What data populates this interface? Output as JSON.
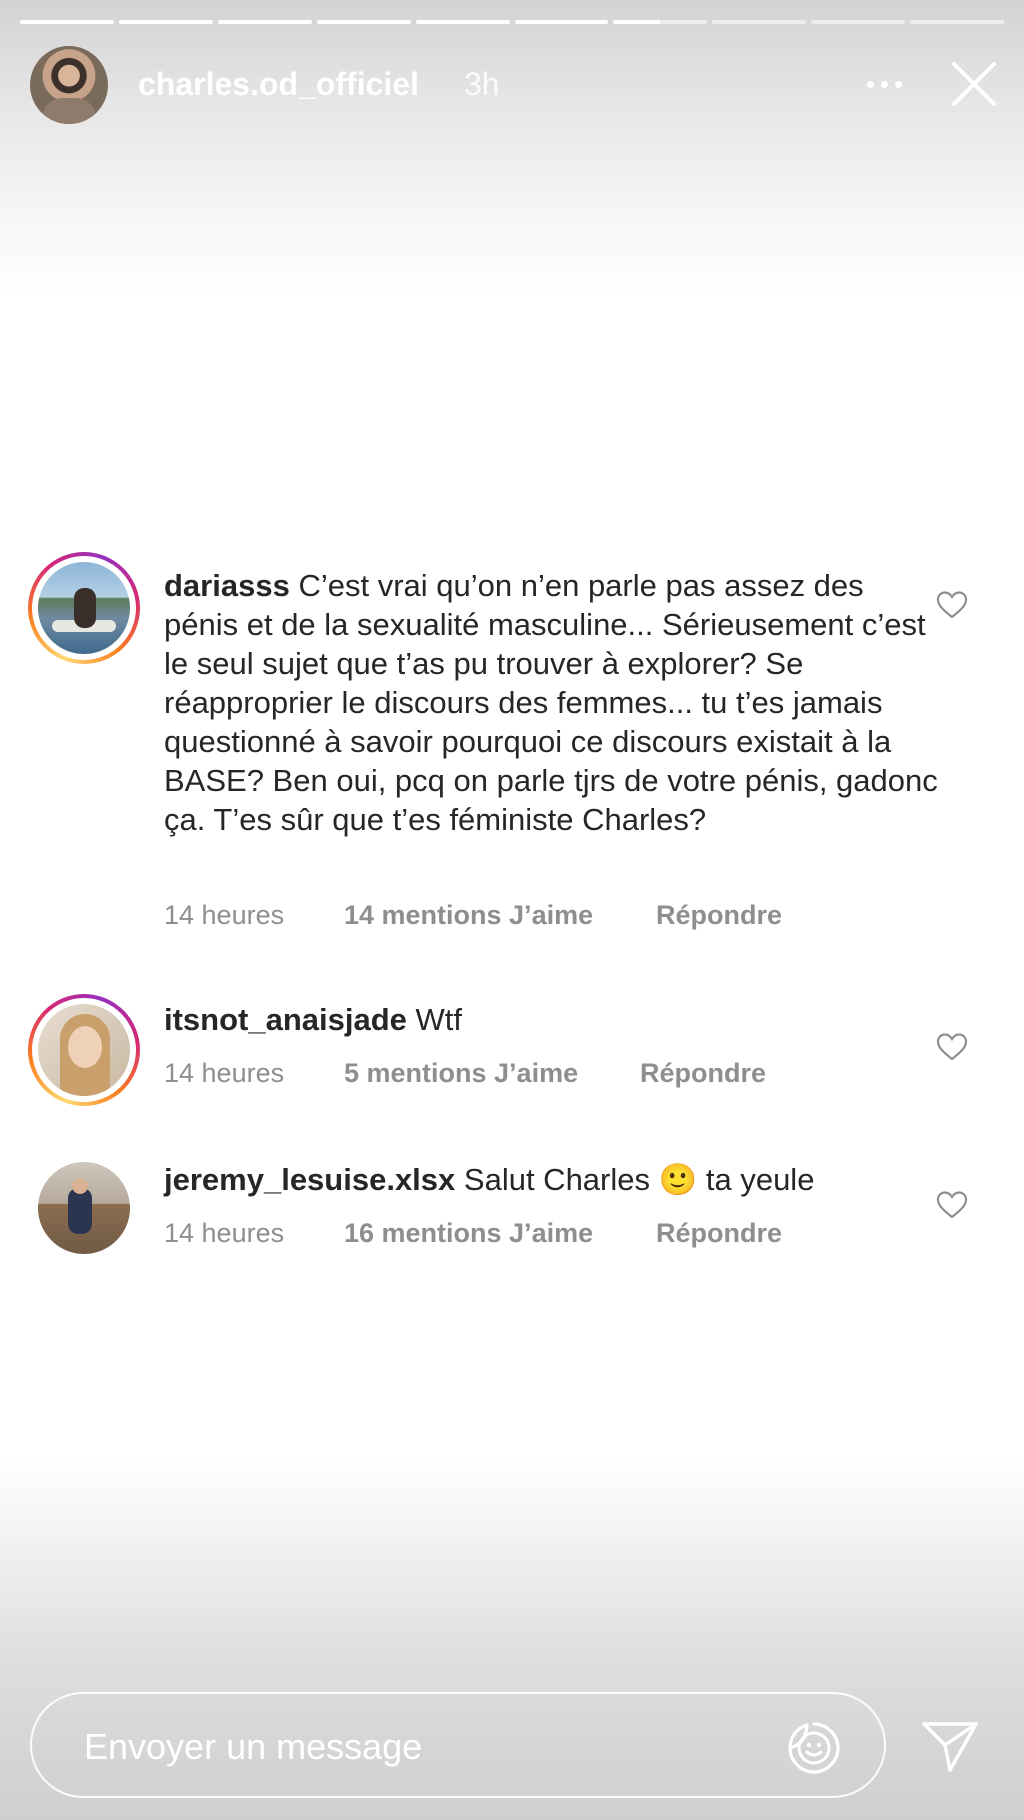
{
  "story": {
    "username": "charles.od_officiel",
    "time": "3h",
    "progress_segments": [
      1,
      1,
      1,
      1,
      1,
      1,
      0.5,
      0,
      0,
      0
    ]
  },
  "comments": [
    {
      "username": "dariasss",
      "text": "C’est vrai qu’on n’en parle pas assez des pénis et de la sexualité masculine... Sérieusement c’est le seul sujet que t’as pu trouver à explorer? Se réapproprier le discours des femmes... tu t’es jamais questionné à savoir pourquoi ce discours existait à la BASE? Ben oui, pcq on parle tjrs de votre pénis, gadonc ça. T’es sûr que t’es féministe Charles?",
      "time": "14 heures",
      "likes": "14 mentions J’aime",
      "reply": "Répondre"
    },
    {
      "username": "itsnot_anaisjade",
      "text": "Wtf",
      "time": "14 heures",
      "likes": "5 mentions J’aime",
      "reply": "Répondre"
    },
    {
      "username": "jeremy_lesuise.xlsx",
      "text_before": "Salut Charles",
      "emoji": "🙂",
      "text_after": "ta yeule",
      "time": "14 heures",
      "likes": "16 mentions J’aime",
      "reply": "Répondre"
    }
  ],
  "composer": {
    "placeholder": "Envoyer un message"
  },
  "icons": {
    "more": "more-dots-icon",
    "close": "close-icon",
    "heart": "heart-outline-icon",
    "sticker": "sticker-icon",
    "send": "send-icon"
  }
}
